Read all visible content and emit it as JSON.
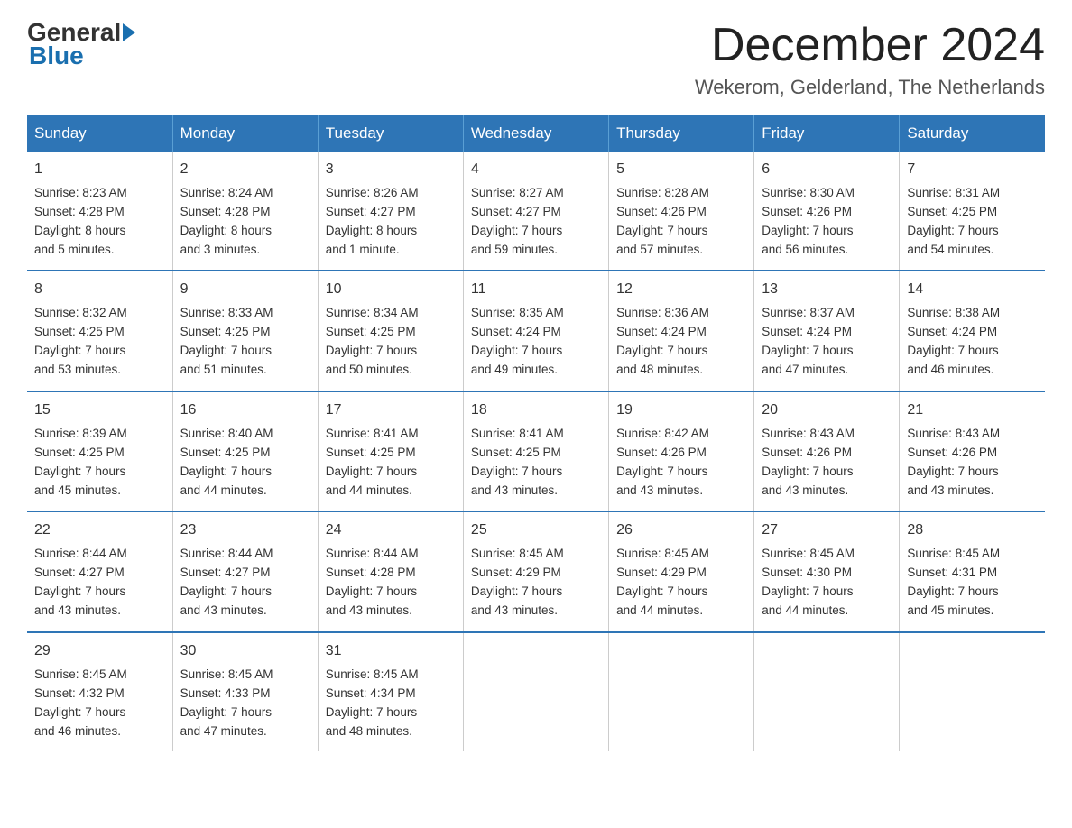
{
  "logo": {
    "general": "General",
    "blue": "Blue"
  },
  "title": "December 2024",
  "location": "Wekerom, Gelderland, The Netherlands",
  "days_header": [
    "Sunday",
    "Monday",
    "Tuesday",
    "Wednesday",
    "Thursday",
    "Friday",
    "Saturday"
  ],
  "weeks": [
    [
      {
        "day": "1",
        "lines": [
          "Sunrise: 8:23 AM",
          "Sunset: 4:28 PM",
          "Daylight: 8 hours",
          "and 5 minutes."
        ]
      },
      {
        "day": "2",
        "lines": [
          "Sunrise: 8:24 AM",
          "Sunset: 4:28 PM",
          "Daylight: 8 hours",
          "and 3 minutes."
        ]
      },
      {
        "day": "3",
        "lines": [
          "Sunrise: 8:26 AM",
          "Sunset: 4:27 PM",
          "Daylight: 8 hours",
          "and 1 minute."
        ]
      },
      {
        "day": "4",
        "lines": [
          "Sunrise: 8:27 AM",
          "Sunset: 4:27 PM",
          "Daylight: 7 hours",
          "and 59 minutes."
        ]
      },
      {
        "day": "5",
        "lines": [
          "Sunrise: 8:28 AM",
          "Sunset: 4:26 PM",
          "Daylight: 7 hours",
          "and 57 minutes."
        ]
      },
      {
        "day": "6",
        "lines": [
          "Sunrise: 8:30 AM",
          "Sunset: 4:26 PM",
          "Daylight: 7 hours",
          "and 56 minutes."
        ]
      },
      {
        "day": "7",
        "lines": [
          "Sunrise: 8:31 AM",
          "Sunset: 4:25 PM",
          "Daylight: 7 hours",
          "and 54 minutes."
        ]
      }
    ],
    [
      {
        "day": "8",
        "lines": [
          "Sunrise: 8:32 AM",
          "Sunset: 4:25 PM",
          "Daylight: 7 hours",
          "and 53 minutes."
        ]
      },
      {
        "day": "9",
        "lines": [
          "Sunrise: 8:33 AM",
          "Sunset: 4:25 PM",
          "Daylight: 7 hours",
          "and 51 minutes."
        ]
      },
      {
        "day": "10",
        "lines": [
          "Sunrise: 8:34 AM",
          "Sunset: 4:25 PM",
          "Daylight: 7 hours",
          "and 50 minutes."
        ]
      },
      {
        "day": "11",
        "lines": [
          "Sunrise: 8:35 AM",
          "Sunset: 4:24 PM",
          "Daylight: 7 hours",
          "and 49 minutes."
        ]
      },
      {
        "day": "12",
        "lines": [
          "Sunrise: 8:36 AM",
          "Sunset: 4:24 PM",
          "Daylight: 7 hours",
          "and 48 minutes."
        ]
      },
      {
        "day": "13",
        "lines": [
          "Sunrise: 8:37 AM",
          "Sunset: 4:24 PM",
          "Daylight: 7 hours",
          "and 47 minutes."
        ]
      },
      {
        "day": "14",
        "lines": [
          "Sunrise: 8:38 AM",
          "Sunset: 4:24 PM",
          "Daylight: 7 hours",
          "and 46 minutes."
        ]
      }
    ],
    [
      {
        "day": "15",
        "lines": [
          "Sunrise: 8:39 AM",
          "Sunset: 4:25 PM",
          "Daylight: 7 hours",
          "and 45 minutes."
        ]
      },
      {
        "day": "16",
        "lines": [
          "Sunrise: 8:40 AM",
          "Sunset: 4:25 PM",
          "Daylight: 7 hours",
          "and 44 minutes."
        ]
      },
      {
        "day": "17",
        "lines": [
          "Sunrise: 8:41 AM",
          "Sunset: 4:25 PM",
          "Daylight: 7 hours",
          "and 44 minutes."
        ]
      },
      {
        "day": "18",
        "lines": [
          "Sunrise: 8:41 AM",
          "Sunset: 4:25 PM",
          "Daylight: 7 hours",
          "and 43 minutes."
        ]
      },
      {
        "day": "19",
        "lines": [
          "Sunrise: 8:42 AM",
          "Sunset: 4:26 PM",
          "Daylight: 7 hours",
          "and 43 minutes."
        ]
      },
      {
        "day": "20",
        "lines": [
          "Sunrise: 8:43 AM",
          "Sunset: 4:26 PM",
          "Daylight: 7 hours",
          "and 43 minutes."
        ]
      },
      {
        "day": "21",
        "lines": [
          "Sunrise: 8:43 AM",
          "Sunset: 4:26 PM",
          "Daylight: 7 hours",
          "and 43 minutes."
        ]
      }
    ],
    [
      {
        "day": "22",
        "lines": [
          "Sunrise: 8:44 AM",
          "Sunset: 4:27 PM",
          "Daylight: 7 hours",
          "and 43 minutes."
        ]
      },
      {
        "day": "23",
        "lines": [
          "Sunrise: 8:44 AM",
          "Sunset: 4:27 PM",
          "Daylight: 7 hours",
          "and 43 minutes."
        ]
      },
      {
        "day": "24",
        "lines": [
          "Sunrise: 8:44 AM",
          "Sunset: 4:28 PM",
          "Daylight: 7 hours",
          "and 43 minutes."
        ]
      },
      {
        "day": "25",
        "lines": [
          "Sunrise: 8:45 AM",
          "Sunset: 4:29 PM",
          "Daylight: 7 hours",
          "and 43 minutes."
        ]
      },
      {
        "day": "26",
        "lines": [
          "Sunrise: 8:45 AM",
          "Sunset: 4:29 PM",
          "Daylight: 7 hours",
          "and 44 minutes."
        ]
      },
      {
        "day": "27",
        "lines": [
          "Sunrise: 8:45 AM",
          "Sunset: 4:30 PM",
          "Daylight: 7 hours",
          "and 44 minutes."
        ]
      },
      {
        "day": "28",
        "lines": [
          "Sunrise: 8:45 AM",
          "Sunset: 4:31 PM",
          "Daylight: 7 hours",
          "and 45 minutes."
        ]
      }
    ],
    [
      {
        "day": "29",
        "lines": [
          "Sunrise: 8:45 AM",
          "Sunset: 4:32 PM",
          "Daylight: 7 hours",
          "and 46 minutes."
        ]
      },
      {
        "day": "30",
        "lines": [
          "Sunrise: 8:45 AM",
          "Sunset: 4:33 PM",
          "Daylight: 7 hours",
          "and 47 minutes."
        ]
      },
      {
        "day": "31",
        "lines": [
          "Sunrise: 8:45 AM",
          "Sunset: 4:34 PM",
          "Daylight: 7 hours",
          "and 48 minutes."
        ]
      },
      {
        "day": "",
        "lines": []
      },
      {
        "day": "",
        "lines": []
      },
      {
        "day": "",
        "lines": []
      },
      {
        "day": "",
        "lines": []
      }
    ]
  ]
}
